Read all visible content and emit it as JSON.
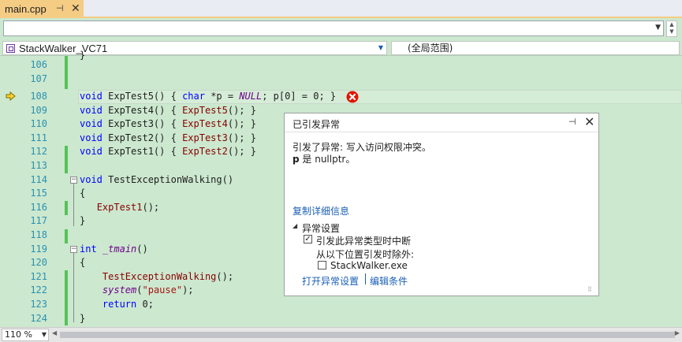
{
  "tab": {
    "filename": "main.cpp",
    "pin_glyph": "⊣",
    "close_glyph": "✕"
  },
  "top_dropdown": {
    "value": ""
  },
  "nav": {
    "project": "StackWalker_VC71",
    "scope": "(全局范围)"
  },
  "editor": {
    "lines": [
      {
        "n": "106"
      },
      {
        "n": "107"
      },
      {
        "n": "108"
      },
      {
        "n": "109"
      },
      {
        "n": "110"
      },
      {
        "n": "111"
      },
      {
        "n": "112"
      },
      {
        "n": "113"
      },
      {
        "n": "114"
      },
      {
        "n": "115"
      },
      {
        "n": "116"
      },
      {
        "n": "117"
      },
      {
        "n": "118"
      },
      {
        "n": "119"
      },
      {
        "n": "120"
      },
      {
        "n": "121"
      },
      {
        "n": "122"
      },
      {
        "n": "123"
      },
      {
        "n": "124"
      }
    ],
    "code": {
      "l105": "}",
      "l108_kw": "void",
      "l108_a": " ExpTest5() { ",
      "l108_char": "char",
      "l108_b": " *p = ",
      "l108_null": "NULL",
      "l108_c": "; p[0] = 0; }",
      "l109_kw": "void",
      "l109_a": " ExpTest4() { ",
      "l109_call": "ExpTest5",
      "l109_b": "(); }",
      "l110_kw": "void",
      "l110_a": " ExpTest3() { ",
      "l110_call": "ExpTest4",
      "l110_b": "(); }",
      "l111_kw": "void",
      "l111_a": " ExpTest2() { ",
      "l111_call": "ExpTest3",
      "l111_b": "(); }",
      "l112_kw": "void",
      "l112_a": " ExpTest1() { ",
      "l112_call": "ExpTest2",
      "l112_b": "(); }",
      "l114_kw": "void",
      "l114_a": " TestExceptionWalking()",
      "l115": "{",
      "l116_call": "ExpTest1",
      "l116_b": "();",
      "l117": "}",
      "l119_kw": "int",
      "l119_a": " ",
      "l119_fn": "_tmain",
      "l119_b": "()",
      "l120": "{",
      "l121_call": "TestExceptionWalking",
      "l121_b": "();",
      "l122_fn": "system",
      "l122_a": "(",
      "l122_str": "\"pause\"",
      "l122_b": ");",
      "l123_kw": "return",
      "l123_a": " 0;",
      "l124": "}"
    }
  },
  "popup": {
    "title": "已引发异常",
    "pin_glyph": "⊣",
    "close_glyph": "✕",
    "message1": "引发了异常: 写入访问权限冲突。",
    "message2_var": "p",
    "message2_rest": " 是 nullptr。",
    "copy_details": "复制详细信息",
    "section_arrow": "◢",
    "section_title": "异常设置",
    "option_break": "引发此异常类型时中断",
    "option_break_checked": true,
    "except_label": "从以下位置引发时除外:",
    "except_item": "StackWalker.exe",
    "except_item_checked": false,
    "open_settings": "打开异常设置",
    "edit_conditions": "编辑条件"
  },
  "status": {
    "zoom": "110 %"
  },
  "colors": {
    "editor_bg": "#cce8cf",
    "tab_active": "#f5cc84",
    "change_bar": "#57c259",
    "error_red": "#e51400"
  }
}
